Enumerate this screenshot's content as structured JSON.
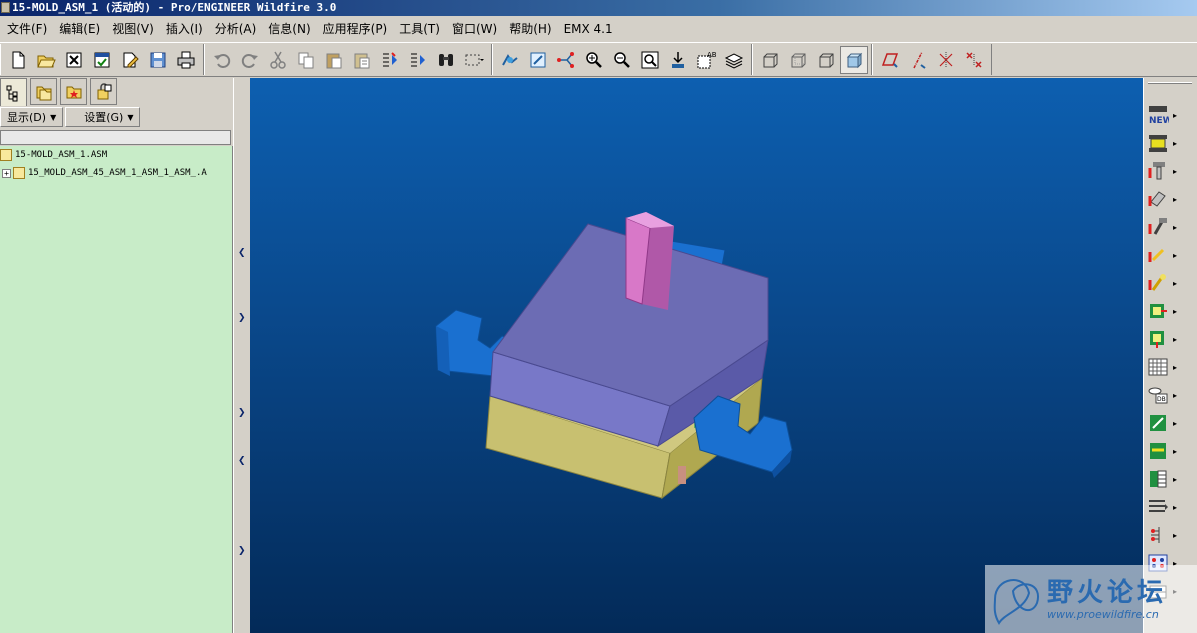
{
  "window": {
    "title": "15-MOLD_ASM_1 (活动的) - Pro/ENGINEER Wildfire 3.0"
  },
  "menu": {
    "items": [
      "文件(F)",
      "编辑(E)",
      "视图(V)",
      "插入(I)",
      "分析(A)",
      "信息(N)",
      "应用程序(P)",
      "工具(T)",
      "窗口(W)",
      "帮助(H)",
      "EMX 4.1"
    ]
  },
  "toolbar": {
    "groups": [
      [
        "new-file-icon",
        "open-folder-icon",
        "erase-icon",
        "save-copy-icon",
        "rename-icon",
        "save-icon",
        "print-icon"
      ],
      [
        "undo-icon",
        "redo-icon",
        "cut-icon",
        "copy-icon",
        "paste-icon",
        "paste-special-icon",
        "regenerate-icon",
        "regen-manager-icon",
        "find-icon",
        "select-box-icon"
      ],
      [
        "repaint-icon",
        "orient-icon",
        "spin-center-icon",
        "zoom-in-icon",
        "zoom-out-icon",
        "refit-icon",
        "view-manager-icon",
        "saved-views-icon",
        "layers-icon"
      ],
      [
        "wireframe-icon",
        "hidden-line-icon",
        "no-hidden-icon",
        "shading-icon"
      ],
      [
        "datum-plane-icon",
        "datum-axis-icon",
        "datum-point-icon",
        "coord-sys-icon"
      ]
    ],
    "pressed": "shading-icon"
  },
  "left_panel": {
    "tabs": [
      "model-tree-tab-icon",
      "folder-browser-tab-icon",
      "favorites-tab-icon",
      "connections-tab-icon"
    ],
    "show_label": "显示(D)",
    "settings_label": "设置(G)",
    "tree": [
      {
        "label": "15-MOLD_ASM_1.ASM",
        "expandable": false
      },
      {
        "label": "15_MOLD_ASM_45_ASM_1_ASM_1_ASM_.A",
        "expandable": true
      }
    ]
  },
  "right_toolbar": {
    "items": [
      "mold-new-icon",
      "mold-base-icon",
      "ejector-pin-icon",
      "slider-icon",
      "lifter-icon",
      "sprue-icon",
      "gate-icon",
      "cooling-icon",
      "insert-icon",
      "pattern-icon",
      "database-icon",
      "water-line-icon",
      "cut-icon",
      "bom-icon",
      "plate-icon",
      "ejector-icon",
      "screw-icon",
      "assembly-icon"
    ]
  },
  "watermark": {
    "cn": "野火论坛",
    "url": "www.proewildfire.cn"
  },
  "colors": {
    "viewport_top": "#0d5fb0",
    "viewport_bottom": "#032a58",
    "tree_bg": "#c8ecc8",
    "plate_top": "#6c6cb4",
    "plate_yellow": "#c8c070",
    "clamp_blue": "#1a70d0",
    "sprue_pink": "#d878c8"
  }
}
